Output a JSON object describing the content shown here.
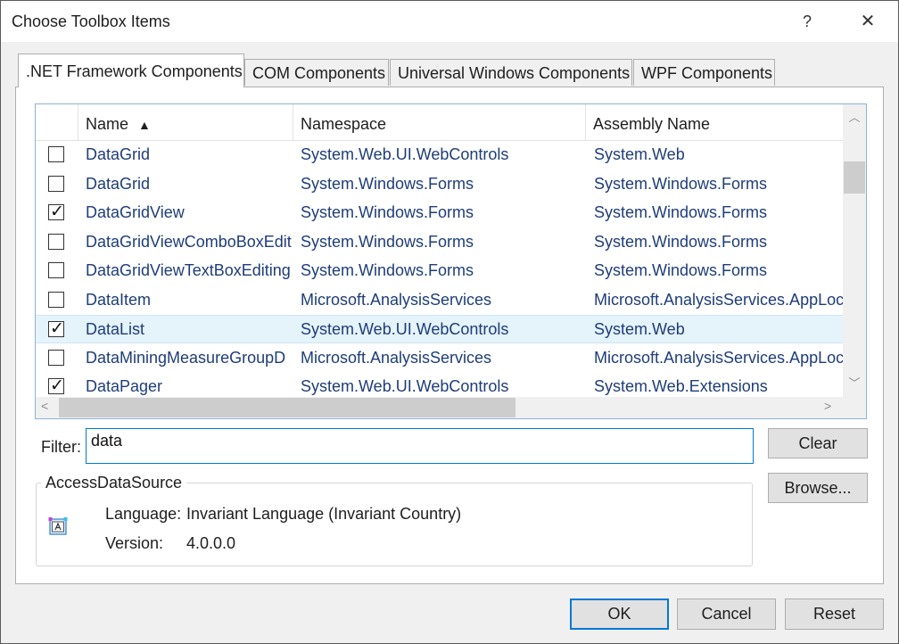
{
  "window": {
    "title": "Choose Toolbox Items",
    "help_label": "?",
    "close_label": "✕"
  },
  "tabs": [
    {
      "label": ".NET Framework Components",
      "active": true
    },
    {
      "label": "COM Components",
      "active": false
    },
    {
      "label": "Universal Windows Components",
      "active": false
    },
    {
      "label": "WPF Components",
      "active": false
    }
  ],
  "grid": {
    "columns": {
      "name": "Name",
      "namespace": "Namespace",
      "assembly": "Assembly Name"
    },
    "sort_indicator": "▲",
    "rows": [
      {
        "checked": false,
        "selected": false,
        "name": "DataGrid",
        "namespace": "System.Web.UI.WebControls",
        "assembly": "System.Web"
      },
      {
        "checked": false,
        "selected": false,
        "name": "DataGrid",
        "namespace": "System.Windows.Forms",
        "assembly": "System.Windows.Forms"
      },
      {
        "checked": true,
        "selected": false,
        "name": "DataGridView",
        "namespace": "System.Windows.Forms",
        "assembly": "System.Windows.Forms"
      },
      {
        "checked": false,
        "selected": false,
        "name": "DataGridViewComboBoxEdit",
        "namespace": "System.Windows.Forms",
        "assembly": "System.Windows.Forms"
      },
      {
        "checked": false,
        "selected": false,
        "name": "DataGridViewTextBoxEditing",
        "namespace": "System.Windows.Forms",
        "assembly": "System.Windows.Forms"
      },
      {
        "checked": false,
        "selected": false,
        "name": "DataItem",
        "namespace": "Microsoft.AnalysisServices",
        "assembly": "Microsoft.AnalysisServices.AppLoca"
      },
      {
        "checked": true,
        "selected": true,
        "name": "DataList",
        "namespace": "System.Web.UI.WebControls",
        "assembly": "System.Web"
      },
      {
        "checked": false,
        "selected": false,
        "name": "DataMiningMeasureGroupD",
        "namespace": "Microsoft.AnalysisServices",
        "assembly": "Microsoft.AnalysisServices.AppLoca"
      },
      {
        "checked": true,
        "selected": false,
        "name": "DataPager",
        "namespace": "System.Web.UI.WebControls",
        "assembly": "System.Web.Extensions"
      }
    ],
    "checkmark": "✓"
  },
  "filter": {
    "label": "Filter:",
    "value": "data"
  },
  "buttons": {
    "clear": "Clear",
    "browse": "Browse...",
    "ok": "OK",
    "cancel": "Cancel",
    "reset": "Reset"
  },
  "details": {
    "component": "AccessDataSource",
    "language_label": "Language:",
    "language_value": "Invariant Language (Invariant Country)",
    "version_label": "Version:",
    "version_value": "4.0.0.0",
    "icon": "component-icon"
  },
  "colors": {
    "link_text": "#1e3d7a",
    "focus_accent": "#0078d7",
    "selected_row": "#e5f3fb"
  }
}
